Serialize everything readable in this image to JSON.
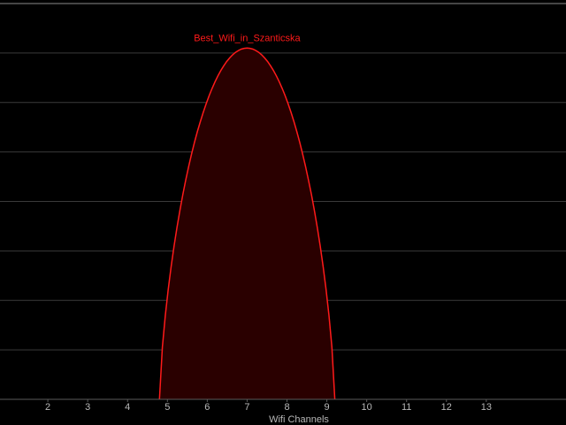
{
  "chart_data": {
    "type": "area",
    "xlabel": "Wifi Channels",
    "ylabel": "",
    "title": "",
    "categories": [
      "2",
      "3",
      "4",
      "5",
      "6",
      "7",
      "8",
      "9",
      "10",
      "11",
      "12",
      "13"
    ],
    "xlim": [
      0.8,
      15.0
    ],
    "ylim": [
      -100,
      -20
    ],
    "grid": true,
    "legend": "none",
    "series": [
      {
        "name": "Best_Wifi_in_Szanticska",
        "center_channel": 7,
        "start_channel": 4.8,
        "end_channel": 9.2,
        "peak_dbm": -29,
        "color": "#ff1a1a",
        "fill": "#2a0000"
      }
    ]
  }
}
